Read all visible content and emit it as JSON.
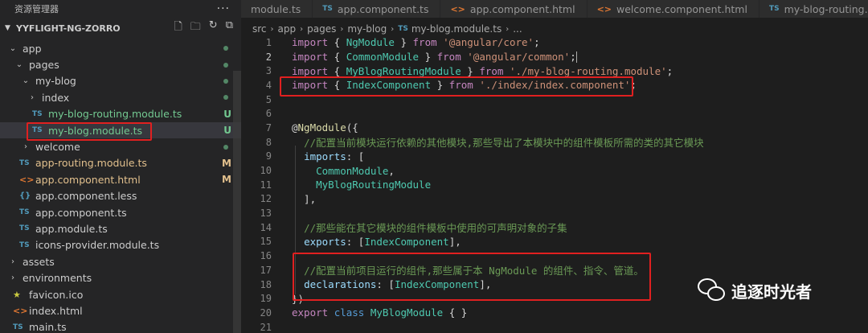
{
  "sidebar": {
    "title": "资源管理器",
    "more": "···",
    "project": "YYFLIGHT-NG-ZORRO",
    "tree": [
      {
        "depth": 1,
        "type": "folder-open",
        "label": "app",
        "status": "dot"
      },
      {
        "depth": 2,
        "type": "folder-open",
        "label": "pages",
        "status": "dot"
      },
      {
        "depth": 3,
        "type": "folder-open",
        "label": "my-blog",
        "status": "dot"
      },
      {
        "depth": 4,
        "type": "folder",
        "label": "index",
        "status": "dot"
      },
      {
        "depth": 4,
        "type": "ts",
        "label": "my-blog-routing.module.ts",
        "status": "U",
        "color": "green"
      },
      {
        "depth": 4,
        "type": "ts",
        "label": "my-blog.module.ts",
        "status": "U",
        "color": "green",
        "selected": true
      },
      {
        "depth": 3,
        "type": "folder",
        "label": "welcome",
        "status": "dot"
      },
      {
        "depth": 2,
        "type": "ts",
        "label": "app-routing.module.ts",
        "status": "M",
        "color": "amber"
      },
      {
        "depth": 2,
        "type": "html",
        "label": "app.component.html",
        "status": "M",
        "color": "amber"
      },
      {
        "depth": 2,
        "type": "less",
        "label": "app.component.less",
        "status": ""
      },
      {
        "depth": 2,
        "type": "ts",
        "label": "app.component.ts",
        "status": ""
      },
      {
        "depth": 2,
        "type": "ts",
        "label": "app.module.ts",
        "status": ""
      },
      {
        "depth": 2,
        "type": "ts",
        "label": "icons-provider.module.ts",
        "status": ""
      },
      {
        "depth": 1,
        "type": "folder",
        "label": "assets",
        "status": ""
      },
      {
        "depth": 1,
        "type": "folder",
        "label": "environments",
        "status": ""
      },
      {
        "depth": 1,
        "type": "ico",
        "label": "favicon.ico",
        "status": ""
      },
      {
        "depth": 1,
        "type": "html",
        "label": "index.html",
        "status": ""
      },
      {
        "depth": 1,
        "type": "ts",
        "label": "main.ts",
        "status": ""
      }
    ]
  },
  "tabs": [
    {
      "icon": "",
      "label": "module.ts"
    },
    {
      "icon": "TS",
      "label": "app.component.ts"
    },
    {
      "icon": "<>",
      "label": "app.component.html"
    },
    {
      "icon": "<>",
      "label": "welcome.component.html"
    },
    {
      "icon": "TS",
      "label": "my-blog-routing.module.ts"
    }
  ],
  "breadcrumb": [
    "src",
    "app",
    "pages",
    "my-blog",
    "my-blog.module.ts",
    "..."
  ],
  "editor": {
    "lines": [
      {
        "n": "1",
        "code": [
          [
            "kw",
            "import"
          ],
          [
            "pun",
            " { "
          ],
          [
            "cls",
            "NgModule"
          ],
          [
            "pun",
            " } "
          ],
          [
            "kw",
            "from"
          ],
          [
            "pun",
            " "
          ],
          [
            "str",
            "'@angular/core'"
          ],
          [
            "pun",
            ";"
          ]
        ]
      },
      {
        "n": "2",
        "code": [
          [
            "kw",
            "import"
          ],
          [
            "pun",
            " { "
          ],
          [
            "cls",
            "CommonModule"
          ],
          [
            "pun",
            " } "
          ],
          [
            "kw",
            "from"
          ],
          [
            "pun",
            " "
          ],
          [
            "str",
            "'@angular/common'"
          ],
          [
            "pun",
            ";"
          ]
        ],
        "caret": true
      },
      {
        "n": "3",
        "code": [
          [
            "kw",
            "import"
          ],
          [
            "pun",
            " { "
          ],
          [
            "cls",
            "MyBlogRoutingModule"
          ],
          [
            "pun",
            " } "
          ],
          [
            "kw",
            "from"
          ],
          [
            "pun",
            " "
          ],
          [
            "str",
            "'./my-blog-routing.module'"
          ],
          [
            "pun",
            ";"
          ]
        ]
      },
      {
        "n": "4",
        "code": [
          [
            "kw",
            "import"
          ],
          [
            "pun",
            " { "
          ],
          [
            "cls",
            "IndexComponent"
          ],
          [
            "pun",
            " } "
          ],
          [
            "kw",
            "from"
          ],
          [
            "pun",
            " "
          ],
          [
            "str",
            "'./index/index.component'"
          ],
          [
            "pun",
            ";"
          ]
        ]
      },
      {
        "n": "5",
        "code": []
      },
      {
        "n": "6",
        "code": []
      },
      {
        "n": "7",
        "code": [
          [
            "pun",
            "@"
          ],
          [
            "dec",
            "NgModule"
          ],
          [
            "pun",
            "({"
          ]
        ]
      },
      {
        "n": "8",
        "code": [
          [
            "pun",
            "  "
          ],
          [
            "cmt",
            "//配置当前模块运行依赖的其他模块,那些导出了本模块中的组件模板所需的类的其它模块"
          ]
        ]
      },
      {
        "n": "9",
        "code": [
          [
            "pun",
            "  "
          ],
          [
            "prop",
            "imports"
          ],
          [
            "pun",
            ": ["
          ]
        ]
      },
      {
        "n": "10",
        "code": [
          [
            "pun",
            "    "
          ],
          [
            "cls",
            "CommonModule"
          ],
          [
            "pun",
            ","
          ]
        ]
      },
      {
        "n": "11",
        "code": [
          [
            "pun",
            "    "
          ],
          [
            "cls",
            "MyBlogRoutingModule"
          ]
        ]
      },
      {
        "n": "12",
        "code": [
          [
            "pun",
            "  ],"
          ]
        ]
      },
      {
        "n": "13",
        "code": []
      },
      {
        "n": "14",
        "code": [
          [
            "pun",
            "  "
          ],
          [
            "cmt",
            "//那些能在其它模块的组件模板中使用的可声明对象的子集"
          ]
        ]
      },
      {
        "n": "15",
        "code": [
          [
            "pun",
            "  "
          ],
          [
            "prop",
            "exports"
          ],
          [
            "pun",
            ": ["
          ],
          [
            "cls",
            "IndexComponent"
          ],
          [
            "pun",
            "],"
          ]
        ]
      },
      {
        "n": "16",
        "code": []
      },
      {
        "n": "17",
        "code": [
          [
            "pun",
            "  "
          ],
          [
            "cmt",
            "//配置当前项目运行的组件,那些属于本 NgModule 的组件、指令、管道。"
          ]
        ]
      },
      {
        "n": "18",
        "code": [
          [
            "pun",
            "  "
          ],
          [
            "prop",
            "declarations"
          ],
          [
            "pun",
            ": ["
          ],
          [
            "cls",
            "IndexComponent"
          ],
          [
            "pun",
            "],"
          ]
        ]
      },
      {
        "n": "19",
        "code": [
          [
            "pun",
            "})"
          ]
        ]
      },
      {
        "n": "20",
        "code": [
          [
            "kw",
            "export"
          ],
          [
            "pun",
            " "
          ],
          [
            "kwb",
            "class"
          ],
          [
            "pun",
            " "
          ],
          [
            "cls",
            "MyBlogModule"
          ],
          [
            "pun",
            " { }"
          ]
        ]
      },
      {
        "n": "21",
        "code": []
      }
    ]
  },
  "watermark": {
    "text": "追逐时光者"
  },
  "colors": {
    "accent_red": "#e02020",
    "untracked": "#73c991",
    "modified": "#e2c08d",
    "ts_icon": "#519aba",
    "html_icon": "#e37933"
  }
}
